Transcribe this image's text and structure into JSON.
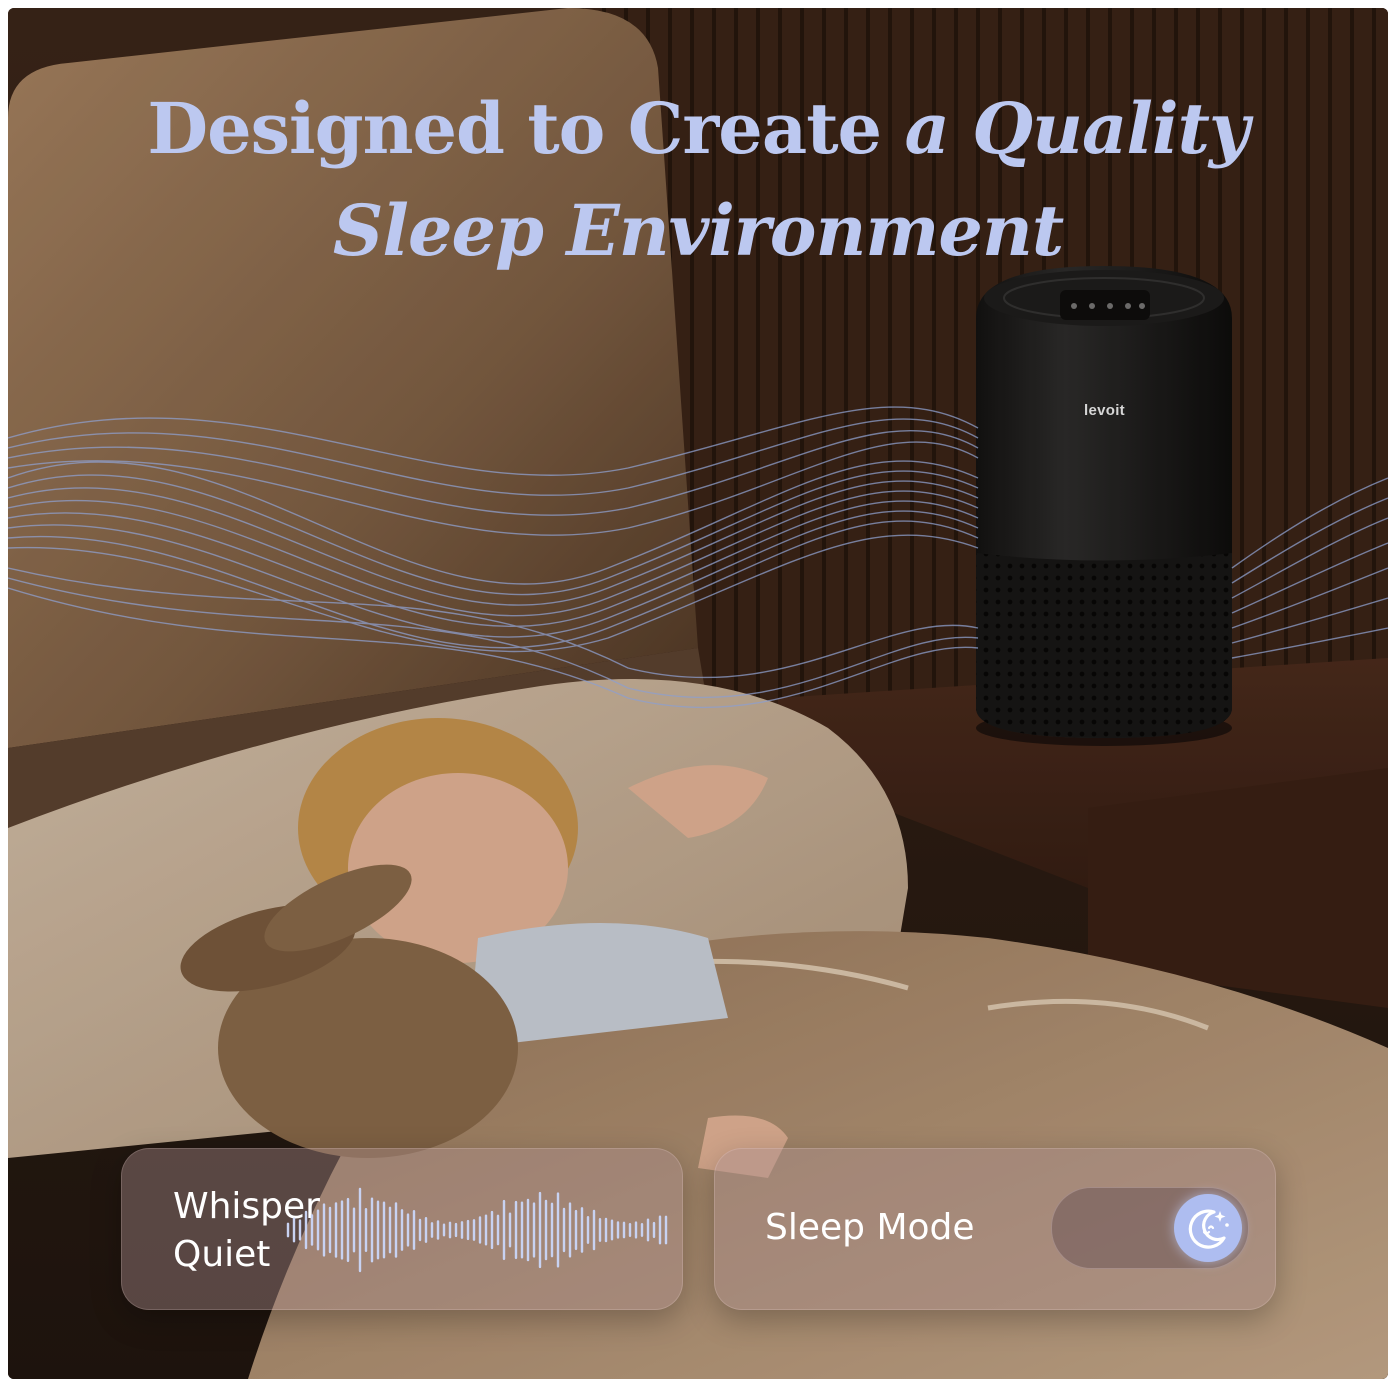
{
  "headline": {
    "line1_part1": "Designed to Create",
    "line1_part2": "a Quality",
    "line2": "Sleep Environment"
  },
  "product": {
    "brand_label": "levoit"
  },
  "features": {
    "whisper_line1": "Whisper",
    "whisper_line2": "Quiet",
    "sleep_mode_label": "Sleep Mode",
    "sleep_mode_state": "on"
  },
  "colors": {
    "headline": "#bcc8f0",
    "toggle_knob": "#aebdf0",
    "card_text": "#ffffff"
  },
  "icons": {
    "sound": "sound-wave-icon",
    "sleep": "moon-stars-icon"
  }
}
